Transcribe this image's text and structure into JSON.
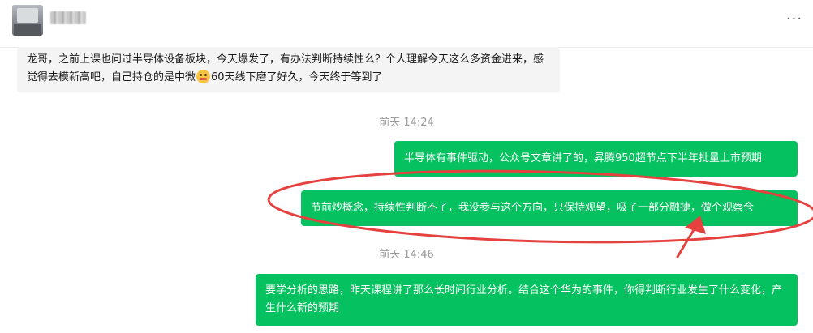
{
  "header": {
    "contact_name": "****",
    "more_icon": "more-horizontal-icon",
    "more_label": "···"
  },
  "messages": {
    "incoming_1": {
      "text_before_emoji": "龙哥，之前上课也问过半导体设备板块，今天爆发了，有办法判断持续性么？个人理解今天这么多资金进来，感觉得去模新高吧，自己持仓的是中微",
      "emoji": "face-icon",
      "text_after_emoji": "60天线下磨了好久，今天终于等到了"
    },
    "timestamp_1": "前天 14:24",
    "outgoing_1": "半导体有事件驱动，公众号文章讲了的，昇腾950超节点下半年批量上市预期",
    "outgoing_2": "节前炒概念，持续性判断不了，我没参与这个方向，只保持观望，吸了一部分融捷，做个观察仓",
    "timestamp_2": "前天 14:46",
    "outgoing_3": "要学分析的思路，昨天课程讲了那么长时间行业分析。结合这个华为的事件，你得判断行业发生了什么变化，产生什么新的预期"
  },
  "colors": {
    "outgoing_bubble": "#06c160",
    "incoming_bubble": "#f4f4f4",
    "annotation": "#e5413f"
  }
}
